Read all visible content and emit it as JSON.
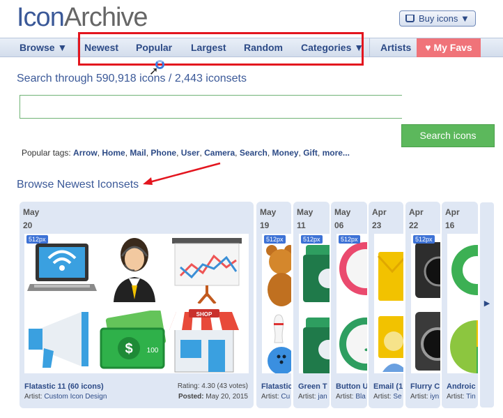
{
  "logo": {
    "part1": "Icon",
    "part2": "Archive"
  },
  "header": {
    "buy_label": "Buy icons ▼"
  },
  "nav": {
    "browse": "Browse ▼",
    "newest": "Newest",
    "popular": "Popular",
    "largest": "Largest",
    "random": "Random",
    "categories": "Categories ▼",
    "artists": "Artists",
    "favs": "♥ My Favs"
  },
  "search": {
    "title": "Search through 590,918 icons / 2,443 iconsets",
    "input_value": "",
    "button": "Search icons"
  },
  "tags": {
    "label": "Popular tags: ",
    "items": [
      "Arrow",
      "Home",
      "Mail",
      "Phone",
      "User",
      "Camera",
      "Search",
      "Money",
      "Gift",
      "more..."
    ]
  },
  "section": {
    "title": "Browse Newest Iconsets"
  },
  "cards": [
    {
      "month": "May",
      "day": "20",
      "badge": "512px",
      "name": "Flatastic 11 (60 icons)",
      "artist_label": "Artist: ",
      "artist": "Custom Icon Design",
      "rating": "Rating: 4.30 (43 votes)",
      "posted_label": "Posted: ",
      "posted": "May 20, 2015"
    },
    {
      "month": "May",
      "day": "19",
      "badge": "512px",
      "name": "Flatastic",
      "artist_label": "Artist: ",
      "artist": "Cu"
    },
    {
      "month": "May",
      "day": "11",
      "badge": "512px",
      "name": "Green T",
      "artist_label": "Artist: ",
      "artist": "jan"
    },
    {
      "month": "May",
      "day": "06",
      "badge": "512px",
      "name": "Button U",
      "artist_label": "Artist: ",
      "artist": "Bla"
    },
    {
      "month": "Apr",
      "day": "23",
      "badge": "",
      "name": "Email (1",
      "artist_label": "Artist: ",
      "artist": "Se"
    },
    {
      "month": "Apr",
      "day": "22",
      "badge": "512px",
      "name": "Flurry C",
      "artist_label": "Artist: ",
      "artist": "iyn"
    },
    {
      "month": "Apr",
      "day": "16",
      "badge": "",
      "name": "Androic",
      "artist_label": "Artist: ",
      "artist": "Tin"
    }
  ],
  "next_arrow": "▶"
}
